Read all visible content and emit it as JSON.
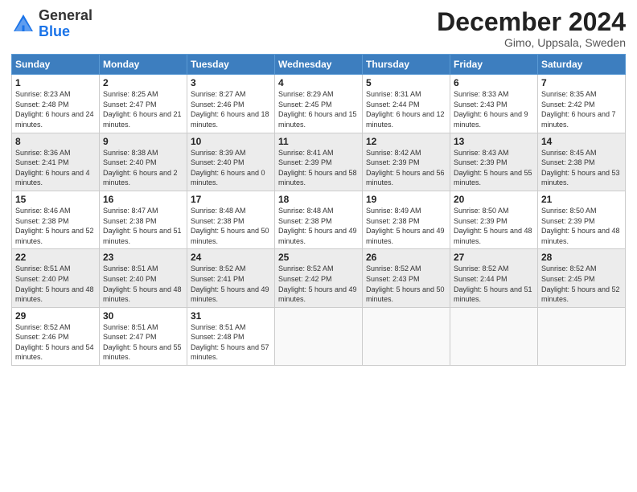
{
  "header": {
    "logo_line1": "General",
    "logo_line2": "Blue",
    "month": "December 2024",
    "location": "Gimo, Uppsala, Sweden"
  },
  "days_of_week": [
    "Sunday",
    "Monday",
    "Tuesday",
    "Wednesday",
    "Thursday",
    "Friday",
    "Saturday"
  ],
  "weeks": [
    [
      {
        "day": "1",
        "sunrise": "Sunrise: 8:23 AM",
        "sunset": "Sunset: 2:48 PM",
        "daylight": "Daylight: 6 hours and 24 minutes."
      },
      {
        "day": "2",
        "sunrise": "Sunrise: 8:25 AM",
        "sunset": "Sunset: 2:47 PM",
        "daylight": "Daylight: 6 hours and 21 minutes."
      },
      {
        "day": "3",
        "sunrise": "Sunrise: 8:27 AM",
        "sunset": "Sunset: 2:46 PM",
        "daylight": "Daylight: 6 hours and 18 minutes."
      },
      {
        "day": "4",
        "sunrise": "Sunrise: 8:29 AM",
        "sunset": "Sunset: 2:45 PM",
        "daylight": "Daylight: 6 hours and 15 minutes."
      },
      {
        "day": "5",
        "sunrise": "Sunrise: 8:31 AM",
        "sunset": "Sunset: 2:44 PM",
        "daylight": "Daylight: 6 hours and 12 minutes."
      },
      {
        "day": "6",
        "sunrise": "Sunrise: 8:33 AM",
        "sunset": "Sunset: 2:43 PM",
        "daylight": "Daylight: 6 hours and 9 minutes."
      },
      {
        "day": "7",
        "sunrise": "Sunrise: 8:35 AM",
        "sunset": "Sunset: 2:42 PM",
        "daylight": "Daylight: 6 hours and 7 minutes."
      }
    ],
    [
      {
        "day": "8",
        "sunrise": "Sunrise: 8:36 AM",
        "sunset": "Sunset: 2:41 PM",
        "daylight": "Daylight: 6 hours and 4 minutes."
      },
      {
        "day": "9",
        "sunrise": "Sunrise: 8:38 AM",
        "sunset": "Sunset: 2:40 PM",
        "daylight": "Daylight: 6 hours and 2 minutes."
      },
      {
        "day": "10",
        "sunrise": "Sunrise: 8:39 AM",
        "sunset": "Sunset: 2:40 PM",
        "daylight": "Daylight: 6 hours and 0 minutes."
      },
      {
        "day": "11",
        "sunrise": "Sunrise: 8:41 AM",
        "sunset": "Sunset: 2:39 PM",
        "daylight": "Daylight: 5 hours and 58 minutes."
      },
      {
        "day": "12",
        "sunrise": "Sunrise: 8:42 AM",
        "sunset": "Sunset: 2:39 PM",
        "daylight": "Daylight: 5 hours and 56 minutes."
      },
      {
        "day": "13",
        "sunrise": "Sunrise: 8:43 AM",
        "sunset": "Sunset: 2:39 PM",
        "daylight": "Daylight: 5 hours and 55 minutes."
      },
      {
        "day": "14",
        "sunrise": "Sunrise: 8:45 AM",
        "sunset": "Sunset: 2:38 PM",
        "daylight": "Daylight: 5 hours and 53 minutes."
      }
    ],
    [
      {
        "day": "15",
        "sunrise": "Sunrise: 8:46 AM",
        "sunset": "Sunset: 2:38 PM",
        "daylight": "Daylight: 5 hours and 52 minutes."
      },
      {
        "day": "16",
        "sunrise": "Sunrise: 8:47 AM",
        "sunset": "Sunset: 2:38 PM",
        "daylight": "Daylight: 5 hours and 51 minutes."
      },
      {
        "day": "17",
        "sunrise": "Sunrise: 8:48 AM",
        "sunset": "Sunset: 2:38 PM",
        "daylight": "Daylight: 5 hours and 50 minutes."
      },
      {
        "day": "18",
        "sunrise": "Sunrise: 8:48 AM",
        "sunset": "Sunset: 2:38 PM",
        "daylight": "Daylight: 5 hours and 49 minutes."
      },
      {
        "day": "19",
        "sunrise": "Sunrise: 8:49 AM",
        "sunset": "Sunset: 2:38 PM",
        "daylight": "Daylight: 5 hours and 49 minutes."
      },
      {
        "day": "20",
        "sunrise": "Sunrise: 8:50 AM",
        "sunset": "Sunset: 2:39 PM",
        "daylight": "Daylight: 5 hours and 48 minutes."
      },
      {
        "day": "21",
        "sunrise": "Sunrise: 8:50 AM",
        "sunset": "Sunset: 2:39 PM",
        "daylight": "Daylight: 5 hours and 48 minutes."
      }
    ],
    [
      {
        "day": "22",
        "sunrise": "Sunrise: 8:51 AM",
        "sunset": "Sunset: 2:40 PM",
        "daylight": "Daylight: 5 hours and 48 minutes."
      },
      {
        "day": "23",
        "sunrise": "Sunrise: 8:51 AM",
        "sunset": "Sunset: 2:40 PM",
        "daylight": "Daylight: 5 hours and 48 minutes."
      },
      {
        "day": "24",
        "sunrise": "Sunrise: 8:52 AM",
        "sunset": "Sunset: 2:41 PM",
        "daylight": "Daylight: 5 hours and 49 minutes."
      },
      {
        "day": "25",
        "sunrise": "Sunrise: 8:52 AM",
        "sunset": "Sunset: 2:42 PM",
        "daylight": "Daylight: 5 hours and 49 minutes."
      },
      {
        "day": "26",
        "sunrise": "Sunrise: 8:52 AM",
        "sunset": "Sunset: 2:43 PM",
        "daylight": "Daylight: 5 hours and 50 minutes."
      },
      {
        "day": "27",
        "sunrise": "Sunrise: 8:52 AM",
        "sunset": "Sunset: 2:44 PM",
        "daylight": "Daylight: 5 hours and 51 minutes."
      },
      {
        "day": "28",
        "sunrise": "Sunrise: 8:52 AM",
        "sunset": "Sunset: 2:45 PM",
        "daylight": "Daylight: 5 hours and 52 minutes."
      }
    ],
    [
      {
        "day": "29",
        "sunrise": "Sunrise: 8:52 AM",
        "sunset": "Sunset: 2:46 PM",
        "daylight": "Daylight: 5 hours and 54 minutes."
      },
      {
        "day": "30",
        "sunrise": "Sunrise: 8:51 AM",
        "sunset": "Sunset: 2:47 PM",
        "daylight": "Daylight: 5 hours and 55 minutes."
      },
      {
        "day": "31",
        "sunrise": "Sunrise: 8:51 AM",
        "sunset": "Sunset: 2:48 PM",
        "daylight": "Daylight: 5 hours and 57 minutes."
      },
      null,
      null,
      null,
      null
    ]
  ]
}
